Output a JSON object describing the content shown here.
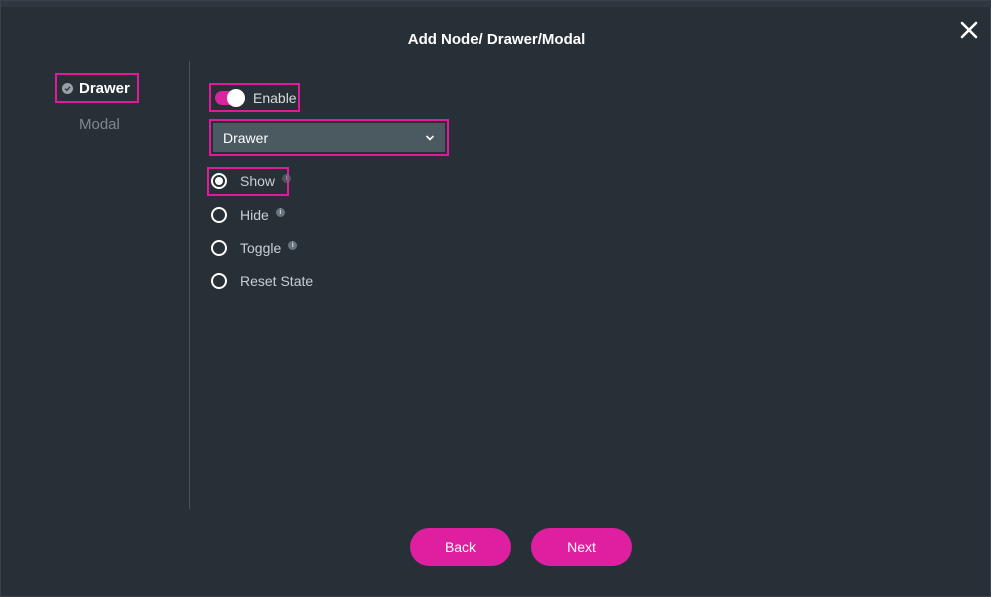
{
  "dialog": {
    "title": "Add Node/ Drawer/Modal"
  },
  "steps": [
    {
      "label": "Drawer",
      "state": "active-complete"
    },
    {
      "label": "Modal",
      "state": "inactive"
    }
  ],
  "enable": {
    "label": "Enable",
    "checked": true
  },
  "dropdown": {
    "selected": "Drawer"
  },
  "radios": [
    {
      "label": "Show",
      "selected": true,
      "info": true
    },
    {
      "label": "Hide",
      "selected": false,
      "info": true
    },
    {
      "label": "Toggle",
      "selected": false,
      "info": true
    },
    {
      "label": "Reset State",
      "selected": false,
      "info": false
    }
  ],
  "info_glyph": "i",
  "buttons": {
    "back": "Back",
    "next": "Next"
  },
  "colors": {
    "accent": "#e01a9b",
    "background": "#283037",
    "dropdown_bg": "#4b5961"
  },
  "icons": {
    "close": "close-icon",
    "check": "check-circle-icon",
    "chevron": "chevron-down-icon",
    "info": "info-icon"
  }
}
